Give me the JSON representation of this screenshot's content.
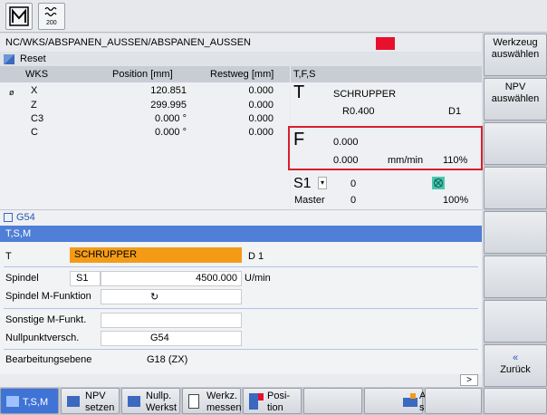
{
  "topbar": {
    "icon1": "M-icon",
    "icon2": "spindle-icon"
  },
  "path": "NC/WKS/ABSPANEN_AUSSEN/ABSPANEN_AUSSEN",
  "reset_label": "Reset",
  "wks": {
    "headers": [
      "WKS",
      "Position [mm]",
      "Restweg [mm]"
    ],
    "rows": [
      {
        "mark": "ø",
        "axis": "X",
        "pos": "120.851",
        "rest": "0.000"
      },
      {
        "mark": "",
        "axis": "Z",
        "pos": "299.995",
        "rest": "0.000"
      },
      {
        "mark": "",
        "axis": "C3",
        "pos": "0.000 °",
        "rest": "0.000"
      },
      {
        "mark": "",
        "axis": "C",
        "pos": "0.000 °",
        "rest": "0.000"
      }
    ]
  },
  "tfs": {
    "header": "T,F,S",
    "t_letter": "T",
    "tool_name": "SCHRUPPER",
    "tool_r": "R0.400",
    "tool_d": "D1",
    "f_letter": "F",
    "f_value1": "0.000",
    "f_value2": "0.000",
    "f_unit": "mm/min",
    "f_override": "110%",
    "s_label": "S1",
    "s_value": "0",
    "master_label": "Master",
    "master_value": "0",
    "s_override": "100%"
  },
  "g54": "G54",
  "tsm_title": "T,S,M",
  "tsm": {
    "t_label": "T",
    "t_value": "SCHRUPPER",
    "d_value": "D 1",
    "spindel_label": "Spindel",
    "spindel_sel": "S1",
    "spindel_speed": "4500.000",
    "spindel_unit": "U/min",
    "mfunk_label": "Spindel M-Funktion",
    "mfunk_value": "↻",
    "sonst_label": "Sonstige M-Funkt.",
    "nullp_label": "Nullpunktversch.",
    "nullp_value": "G54",
    "bearb_label": "Bearbeitungsebene",
    "bearb_value": "G18 (ZX)"
  },
  "scroll_label": ">",
  "right_softkeys": [
    {
      "label1": "Werkzeug",
      "label2": "auswählen"
    },
    {
      "label1": "NPV",
      "label2": "auswählen"
    },
    {
      "label1": "",
      "label2": ""
    },
    {
      "label1": "",
      "label2": ""
    },
    {
      "label1": "",
      "label2": ""
    },
    {
      "label1": "",
      "label2": ""
    },
    {
      "label1": "",
      "label2": ""
    },
    {
      "label1": "«",
      "label2": "Zurück"
    }
  ],
  "bottom_softkeys": [
    {
      "label1": "T,S,M",
      "label2": ""
    },
    {
      "label1": "NPV",
      "label2": "setzen"
    },
    {
      "label1": "Nullp.",
      "label2": "Werkst"
    },
    {
      "label1": "Werkz.",
      "label2": "messen"
    },
    {
      "label1": "Posi-",
      "label2": "tion"
    },
    {
      "label1": "",
      "label2": ""
    },
    {
      "label1": "Ab-",
      "label2": "spanen"
    },
    {
      "label1": "",
      "label2": ""
    }
  ],
  "colors": {
    "accent_blue": "#4f7fd6",
    "alarm_red": "#e8112d",
    "highlight_orange": "#f39b17",
    "box_red": "#d71f2e",
    "spindle_icon_green": "#46c8b0"
  }
}
